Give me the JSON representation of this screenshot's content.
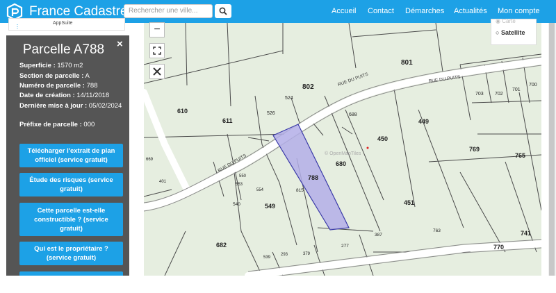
{
  "header": {
    "brand": "France Cadastre",
    "search_placeholder": "Rechercher une ville...",
    "nav": [
      "Accueil",
      "Contact",
      "Démarches",
      "Actualités",
      "Mon compte"
    ]
  },
  "sidebar": {
    "appsuite_label": "AppSuite"
  },
  "parcel": {
    "title": "Parcelle A788",
    "close": "×",
    "fields": [
      {
        "label": "Superficie :",
        "value": "1570 m2"
      },
      {
        "label": "Section de parcelle :",
        "value": "A"
      },
      {
        "label": "Numéro de parcelle :",
        "value": "788"
      },
      {
        "label": "Date de création :",
        "value": "14/11/2018"
      },
      {
        "label": "Dernière mise à jour :",
        "value": "05/02/2024"
      },
      {
        "label": "Préfixe de parcelle :",
        "value": "000"
      }
    ],
    "buttons": [
      "Télécharger l'extrait de plan officiel (service gratuit)",
      "Étude des risques (service gratuit)",
      "Cette parcelle est-elle constructible ? (service gratuit)",
      "Qui est le propriétaire ? (service gratuit)"
    ]
  },
  "map": {
    "layers": [
      "Carte",
      "Satellite"
    ],
    "watermark": "© OpenMapTiles",
    "street_labels": [
      "RUE DU PUITS",
      "RUE DU PUITS",
      "RUE DU PUITS"
    ],
    "parcels": [
      "801",
      "802",
      "703",
      "702",
      "701",
      "700",
      "610",
      "611",
      "526",
      "524",
      "688",
      "449",
      "450",
      "769",
      "765",
      "669",
      "680",
      "788",
      "815",
      "549",
      "540",
      "451",
      "763",
      "741",
      "682",
      "770",
      "387",
      "277",
      "539",
      "293",
      "379",
      "401",
      "550",
      "553",
      "554"
    ],
    "selected_parcel": "788",
    "colors": {
      "selected_fill": "#b3aee8",
      "selected_stroke": "#3a3aa8",
      "map_bg": "#e6eee0",
      "road": "#ffffff"
    }
  },
  "colors": {
    "topbar": "#1da1e6",
    "panel_bg": "#555555",
    "button_bg": "#1da1e6"
  }
}
